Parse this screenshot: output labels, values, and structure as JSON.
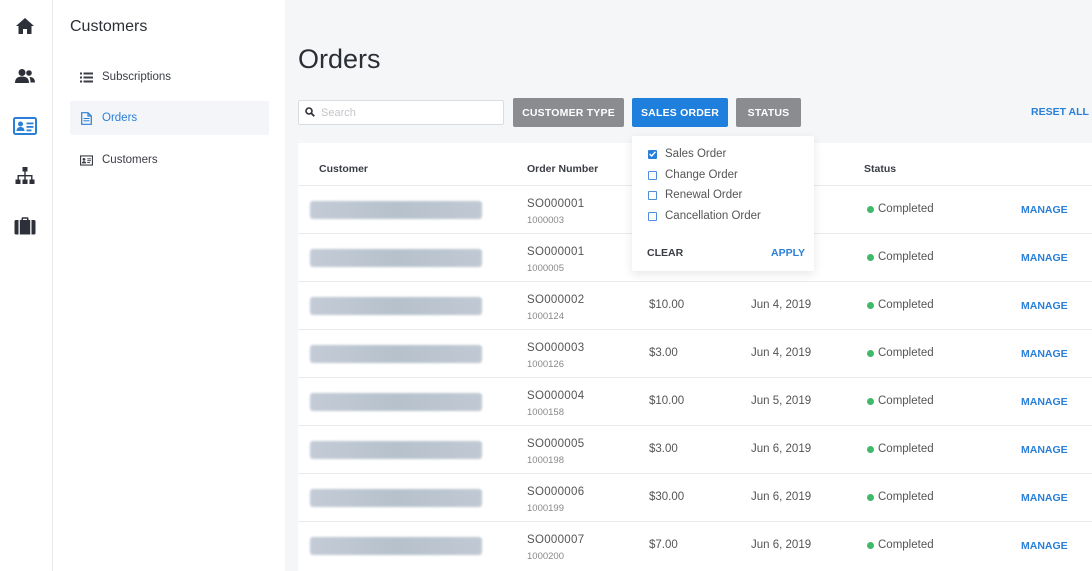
{
  "rail": {
    "icons": [
      "home-icon",
      "users-icon",
      "contact-card-icon",
      "org-chart-icon",
      "briefcase-icon"
    ],
    "active": "contact-card-icon",
    "accent": "#2a7fd8"
  },
  "subnav": {
    "title": "Customers",
    "items": [
      {
        "label": "Subscriptions",
        "icon": "list-icon",
        "active": false
      },
      {
        "label": "Orders",
        "icon": "document-icon",
        "active": true
      },
      {
        "label": "Customers",
        "icon": "contact-card-icon",
        "active": false
      }
    ]
  },
  "page": {
    "title": "Orders"
  },
  "filters": {
    "search_placeholder": "Search",
    "customer_type": "CUSTOMER TYPE",
    "sales_order": "SALES ORDER",
    "status": "STATUS",
    "reset_all": "RESET ALL"
  },
  "dropdown": {
    "options": [
      {
        "label": "Sales Order",
        "checked": true
      },
      {
        "label": "Change Order",
        "checked": false
      },
      {
        "label": "Renewal Order",
        "checked": false
      },
      {
        "label": "Cancellation Order",
        "checked": false
      }
    ],
    "clear": "CLEAR",
    "apply": "APPLY"
  },
  "table": {
    "headers": {
      "customer": "Customer",
      "order_number": "Order Number",
      "status": "Status"
    },
    "manage_label": "MANAGE",
    "status_color": "#3fb96a",
    "rows": [
      {
        "order": "SO000001",
        "sub": "1000003",
        "amount": "",
        "date": "",
        "status": "Completed"
      },
      {
        "order": "SO000001",
        "sub": "1000005",
        "amount": "",
        "date": "",
        "status": "Completed"
      },
      {
        "order": "SO000002",
        "sub": "1000124",
        "amount": "$10.00",
        "date": "Jun 4, 2019",
        "status": "Completed"
      },
      {
        "order": "SO000003",
        "sub": "1000126",
        "amount": "$3.00",
        "date": "Jun 4, 2019",
        "status": "Completed"
      },
      {
        "order": "SO000004",
        "sub": "1000158",
        "amount": "$10.00",
        "date": "Jun 5, 2019",
        "status": "Completed"
      },
      {
        "order": "SO000005",
        "sub": "1000198",
        "amount": "$3.00",
        "date": "Jun 6, 2019",
        "status": "Completed"
      },
      {
        "order": "SO000006",
        "sub": "1000199",
        "amount": "$30.00",
        "date": "Jun 6, 2019",
        "status": "Completed"
      },
      {
        "order": "SO000007",
        "sub": "1000200",
        "amount": "$7.00",
        "date": "Jun 6, 2019",
        "status": "Completed"
      }
    ]
  }
}
